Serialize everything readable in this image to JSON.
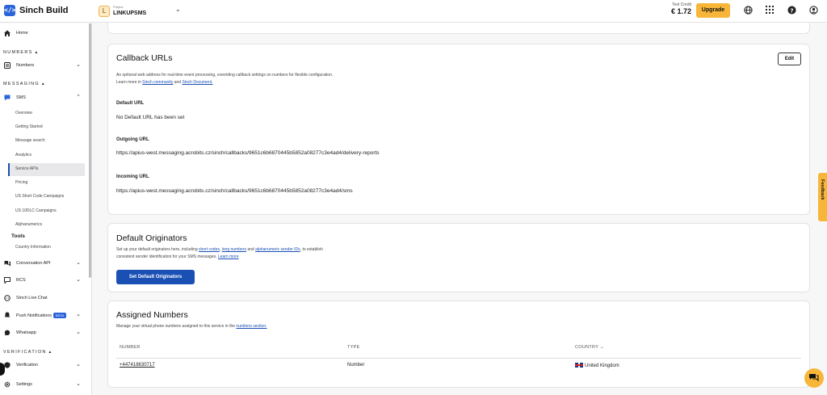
{
  "topbar": {
    "brand": "Sinch Build",
    "logo_glyph": "</>",
    "project_avatar": "L",
    "project_kicker": "Project",
    "project_name": "LINKUPSMS",
    "credit_label": "Test Credit",
    "credit_value": "€ 1.72",
    "upgrade_label": "Upgrade"
  },
  "sidebar": {
    "home": "Home",
    "numbers_section": "NUMBERS",
    "numbers": "Numbers",
    "messaging_section": "MESSAGING",
    "sms": "SMS",
    "sms_items": [
      "Overview",
      "Getting Started",
      "Message search",
      "Analytics",
      "Service APIs",
      "Pricing",
      "US Short Code Campaigns",
      "US 10DLC Campaigns",
      "Alphanumerics"
    ],
    "tools_label": "Tools",
    "country_info": "Country Information",
    "conversation_api": "Conversation API",
    "rcs": "RCS",
    "live_chat": "Sinch Live Chat",
    "push": "Push Notifications",
    "beta": "BETA",
    "whatsapp": "Whatsapp",
    "verification_section": "VERIFICATION",
    "verification": "Verification",
    "settings": "Settings"
  },
  "callback": {
    "title": "Callback URLs",
    "edit_label": "Edit",
    "desc_1": "An optional web address for real-time event processing, overriding callback settings on numbers for flexible configuration.",
    "desc_2_prefix": "Learn more in ",
    "desc_2_link1": "Sinch community",
    "desc_2_mid": " and ",
    "desc_2_link2": "Sinch Document.",
    "default_label": "Default URL",
    "default_value": "No Default URL has been set",
    "outgoing_label": "Outgoing URL",
    "outgoing_value": "https://apius-west.messaging.acrobits.cz/sinch/callbacks/9651c6b6870445b5852a08277c3e4ad4/delivery-reports",
    "incoming_label": "Incoming URL",
    "incoming_value": "https://apius-west.messaging.acrobits.cz/sinch/callbacks/9651c6b6870445b5852a08277c3e4ad4/sms"
  },
  "originators": {
    "title": "Default Originators",
    "desc_1a": "Set up your default originators here, including ",
    "desc_1_link1": "short codes",
    "desc_1b": ", ",
    "desc_1_link2": "long numbers",
    "desc_1c": " and ",
    "desc_1_link3": "alphanumeric sender IDs",
    "desc_1d": ", to establish",
    "desc_2": "consistent sender identification for your SMS messages. ",
    "desc_2_link": "Learn more",
    "button_label": "Set Default Originators"
  },
  "assigned": {
    "title": "Assigned Numbers",
    "desc_prefix": "Manage your virtual phone numbers assigned to this service in the ",
    "desc_link": "numbers section.",
    "columns": [
      "NUMBER",
      "TYPE",
      "COUNTRY"
    ],
    "sort_glyph": "⌄",
    "rows": [
      {
        "number": "+447418630717",
        "type": "Number",
        "country": "United Kingdom"
      }
    ]
  },
  "feedback_label": "Feedback",
  "colors": {
    "accent": "#1a4fb4",
    "upgrade": "#f7b63a",
    "logo": "#2a64d8"
  }
}
